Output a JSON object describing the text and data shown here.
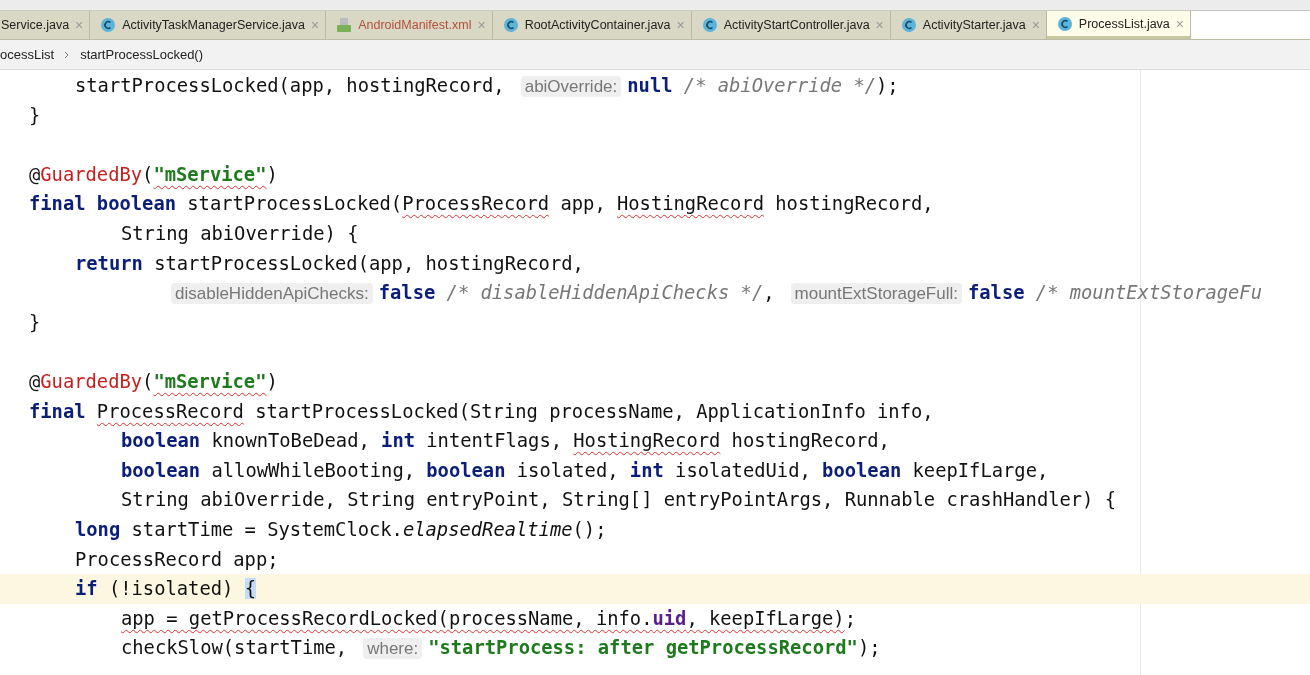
{
  "tabs": [
    {
      "label": "Service.java",
      "kind": "class",
      "selected": false,
      "close": "×"
    },
    {
      "label": "ActivityTaskManagerService.java",
      "kind": "class",
      "selected": false,
      "close": "×"
    },
    {
      "label": "AndroidManifest.xml",
      "kind": "manifest",
      "selected": false,
      "close": "×"
    },
    {
      "label": "RootActivityContainer.java",
      "kind": "class",
      "selected": false,
      "close": "×"
    },
    {
      "label": "ActivityStartController.java",
      "kind": "class",
      "selected": false,
      "close": "×"
    },
    {
      "label": "ActivityStarter.java",
      "kind": "class",
      "selected": false,
      "close": "×"
    },
    {
      "label": "ProcessList.java",
      "kind": "class",
      "selected": true,
      "close": "×"
    }
  ],
  "breadcrumb": [
    "ocessList",
    "startProcessLocked()"
  ],
  "code_lines": [
    {
      "kind": "body",
      "current": false,
      "tokens": [
        {
          "t": "startProcessLocked(app, hostingRecord,",
          "kind": "plain"
        },
        {
          "t": "abiOverride:",
          "kind": "hint"
        },
        {
          "t": "null",
          "kind": "kw"
        },
        {
          "t": " /* abiOverride */",
          "kind": "cmt"
        },
        {
          "t": ");",
          "kind": "plain"
        }
      ]
    },
    {
      "kind": "top",
      "current": false,
      "tokens": [
        {
          "t": "}",
          "kind": "plain"
        }
      ]
    },
    {
      "kind": "blank",
      "current": false
    },
    {
      "kind": "top",
      "current": false,
      "tokens": [
        {
          "t": "@",
          "kind": "plain"
        },
        {
          "t": "GuardedBy",
          "kind": "ann"
        },
        {
          "t": "(",
          "kind": "plain"
        },
        {
          "t": "\"mService\"",
          "kind": "str",
          "warn": true
        },
        {
          "t": ")",
          "kind": "plain"
        }
      ]
    },
    {
      "kind": "top",
      "current": false,
      "tokens": [
        {
          "t": "final boolean",
          "kind": "kw"
        },
        {
          "t": " startProcessLocked(",
          "kind": "plain"
        },
        {
          "t": "ProcessRecord",
          "kind": "plain",
          "warn": true
        },
        {
          "t": " app, ",
          "kind": "plain"
        },
        {
          "t": "HostingRecord",
          "kind": "plain",
          "warn": true
        },
        {
          "t": " hostingRecord,",
          "kind": "plain"
        }
      ]
    },
    {
      "kind": "cont",
      "current": false,
      "tokens": [
        {
          "t": "String abiOverride) {",
          "kind": "plain"
        }
      ]
    },
    {
      "kind": "body",
      "current": false,
      "tokens": [
        {
          "t": "return",
          "kind": "kw"
        },
        {
          "t": " startProcessLocked(app, hostingRecord,",
          "kind": "plain"
        }
      ]
    },
    {
      "kind": "arg",
      "current": false,
      "tokens": [
        {
          "t": "disableHiddenApiChecks:",
          "kind": "hint"
        },
        {
          "t": "false",
          "kind": "kw"
        },
        {
          "t": " /* disableHiddenApiChecks */",
          "kind": "cmt"
        },
        {
          "t": ",",
          "kind": "plain"
        },
        {
          "t": "mountExtStorageFull:",
          "kind": "hint"
        },
        {
          "t": "false",
          "kind": "kw"
        },
        {
          "t": " /* mountExtStorageFu",
          "kind": "cmt"
        }
      ]
    },
    {
      "kind": "top",
      "current": false,
      "tokens": [
        {
          "t": "}",
          "kind": "plain"
        }
      ]
    },
    {
      "kind": "blank",
      "current": false
    },
    {
      "kind": "top",
      "current": false,
      "tokens": [
        {
          "t": "@",
          "kind": "plain"
        },
        {
          "t": "GuardedBy",
          "kind": "ann"
        },
        {
          "t": "(",
          "kind": "plain"
        },
        {
          "t": "\"mService\"",
          "kind": "str",
          "warn": true
        },
        {
          "t": ")",
          "kind": "plain"
        }
      ]
    },
    {
      "kind": "top",
      "current": false,
      "tokens": [
        {
          "t": "final ",
          "kind": "kw"
        },
        {
          "t": "ProcessRecord",
          "kind": "plain",
          "warn": true
        },
        {
          "t": " startProcessLocked(String processName, ApplicationInfo info,",
          "kind": "plain"
        }
      ]
    },
    {
      "kind": "cont",
      "current": false,
      "tokens": [
        {
          "t": "boolean",
          "kind": "kw"
        },
        {
          "t": " knownToBeDead, ",
          "kind": "plain"
        },
        {
          "t": "int",
          "kind": "kw"
        },
        {
          "t": " intentFlags, ",
          "kind": "plain"
        },
        {
          "t": "HostingRecord",
          "kind": "plain",
          "warn": true
        },
        {
          "t": " hostingRecord,",
          "kind": "plain"
        }
      ]
    },
    {
      "kind": "cont",
      "current": false,
      "tokens": [
        {
          "t": "boolean",
          "kind": "kw"
        },
        {
          "t": " allowWhileBooting, ",
          "kind": "plain"
        },
        {
          "t": "boolean",
          "kind": "kw"
        },
        {
          "t": " isolated, ",
          "kind": "plain"
        },
        {
          "t": "int",
          "kind": "kw"
        },
        {
          "t": " isolatedUid, ",
          "kind": "plain"
        },
        {
          "t": "boolean",
          "kind": "kw"
        },
        {
          "t": " keepIfLarge,",
          "kind": "plain"
        }
      ]
    },
    {
      "kind": "cont",
      "current": false,
      "tokens": [
        {
          "t": "String abiOverride, String entryPoint, String[] entryPointArgs, Runnable crashHandler) {",
          "kind": "plain"
        }
      ]
    },
    {
      "kind": "body",
      "current": false,
      "tokens": [
        {
          "t": "long",
          "kind": "kw"
        },
        {
          "t": " startTime = SystemClock.",
          "kind": "plain"
        },
        {
          "t": "elapsedRealtime",
          "kind": "it"
        },
        {
          "t": "();",
          "kind": "plain"
        }
      ]
    },
    {
      "kind": "body",
      "current": false,
      "tokens": [
        {
          "t": "ProcessRecord app;",
          "kind": "plain"
        }
      ]
    },
    {
      "kind": "body",
      "current": true,
      "tokens": [
        {
          "t": "if",
          "kind": "kw"
        },
        {
          "t": " (!isolated) ",
          "kind": "plain"
        },
        {
          "t": "{",
          "kind": "brace"
        }
      ]
    },
    {
      "kind": "cont",
      "current": false,
      "tokens": [
        {
          "t": "app = getProcessRecordLocked(processName, info.",
          "kind": "plain",
          "warn": true
        },
        {
          "t": "uid",
          "kind": "field",
          "warn": true
        },
        {
          "t": ", keepIfLarge)",
          "kind": "plain",
          "warn": true
        },
        {
          "t": ";",
          "kind": "plain"
        }
      ]
    },
    {
      "kind": "cont",
      "current": false,
      "tokens": [
        {
          "t": "checkSlow(startTime,",
          "kind": "plain"
        },
        {
          "t": "where:",
          "kind": "hint"
        },
        {
          "t": "\"startProcess: after getProcessRecord\"",
          "kind": "str"
        },
        {
          "t": ");",
          "kind": "plain"
        }
      ]
    }
  ]
}
